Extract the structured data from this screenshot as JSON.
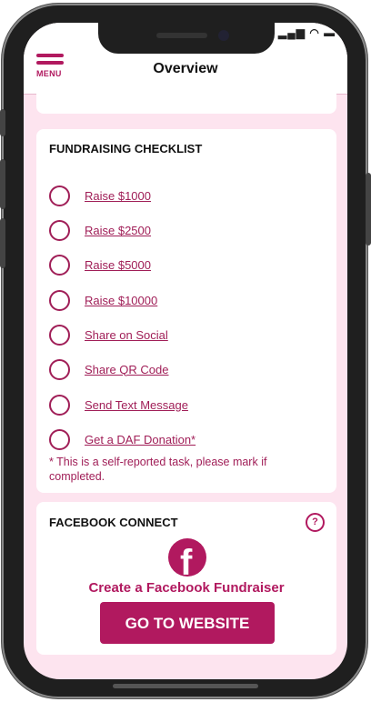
{
  "header": {
    "menu_label": "MENU",
    "title": "Overview"
  },
  "checklist": {
    "title": "FUNDRAISING CHECKLIST",
    "items": [
      {
        "label": "Raise $1000"
      },
      {
        "label": "Raise $2500"
      },
      {
        "label": "Raise $5000"
      },
      {
        "label": "Raise $10000"
      },
      {
        "label": "Share on Social"
      },
      {
        "label": "Share QR Code"
      },
      {
        "label": "Send Text Message"
      },
      {
        "label": "Get a DAF Donation*"
      }
    ],
    "note": "* This is a self-reported task, please mark if completed."
  },
  "facebook": {
    "title": "FACEBOOK CONNECT",
    "help_symbol": "?",
    "logo_letter": "f",
    "caption": "Create a Facebook Fundraiser",
    "button_label": "GO TO WEBSITE"
  },
  "colors": {
    "brand": "#b1195f",
    "link": "#a01e57",
    "background": "#fde4ef"
  },
  "icons": {
    "menu": "hamburger-icon",
    "help": "question-circle-icon",
    "facebook": "facebook-logo-icon",
    "checkbox": "empty-circle-icon"
  }
}
